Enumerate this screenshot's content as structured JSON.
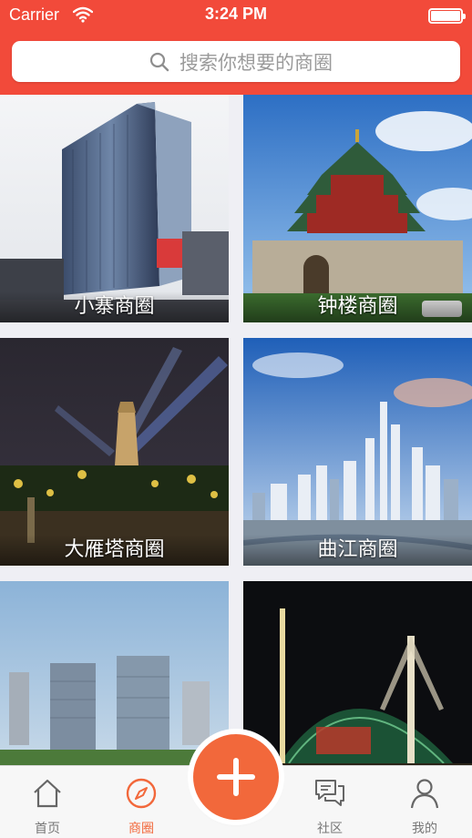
{
  "status_bar": {
    "carrier": "Carrier",
    "time": "3:24 PM"
  },
  "search": {
    "placeholder": "搜索你想要的商圈"
  },
  "districts": [
    {
      "name": "小寨商圈"
    },
    {
      "name": "钟楼商圈"
    },
    {
      "name": "大雁塔商圈"
    },
    {
      "name": "曲江商圈"
    },
    {
      "name": ""
    },
    {
      "name": ""
    }
  ],
  "tabbar": {
    "items": [
      {
        "label": "首页",
        "icon": "home-icon"
      },
      {
        "label": "商圈",
        "icon": "compass-icon",
        "active": true
      },
      {
        "label": "社区",
        "icon": "chat-bubbles-icon"
      },
      {
        "label": "我的",
        "icon": "person-icon"
      }
    ],
    "add_icon": "plus-icon"
  },
  "colors": {
    "header": "#f24a3a",
    "accent": "#f2683b",
    "tabbar_bg": "#f7f7f7",
    "page_bg": "#efeff4"
  }
}
